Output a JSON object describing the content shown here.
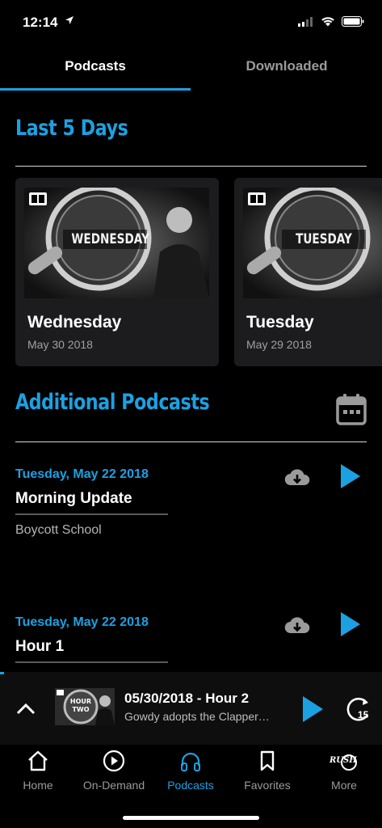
{
  "status_bar": {
    "time": "12:14"
  },
  "tabs": [
    {
      "label": "Podcasts",
      "active": true
    },
    {
      "label": "Downloaded",
      "active": false
    }
  ],
  "sections": {
    "last_days": "Last 5 Days",
    "additional": "Additional Podcasts"
  },
  "cards": [
    {
      "title": "Wednesday",
      "date": "May 30 2018",
      "art_text": "WEDNESDAY"
    },
    {
      "title": "Tuesday",
      "date": "May 29 2018",
      "art_text": "TUESDAY"
    }
  ],
  "episodes": [
    {
      "date": "Tuesday, May 22 2018",
      "title": "Morning Update",
      "subtitle": "Boycott School"
    },
    {
      "date": "Tuesday, May 22 2018",
      "title": "Hour 1",
      "subtitle": ""
    }
  ],
  "mini_player": {
    "title": "05/30/2018 - Hour 2",
    "subtitle": "Gowdy adopts the Clapper…",
    "art_text": "HOUR TWO",
    "skip_seconds": "15"
  },
  "tab_bar": [
    {
      "label": "Home",
      "icon": "home-icon"
    },
    {
      "label": "On-Demand",
      "icon": "play-circle-icon"
    },
    {
      "label": "Podcasts",
      "icon": "headphones-icon",
      "active": true
    },
    {
      "label": "Favorites",
      "icon": "bookmark-icon"
    },
    {
      "label": "More",
      "icon": "rush-logo-icon",
      "logo_text": "RUSH"
    }
  ],
  "colors": {
    "accent": "#1ba1e2",
    "background": "#000000",
    "card": "#1c1c1e"
  }
}
